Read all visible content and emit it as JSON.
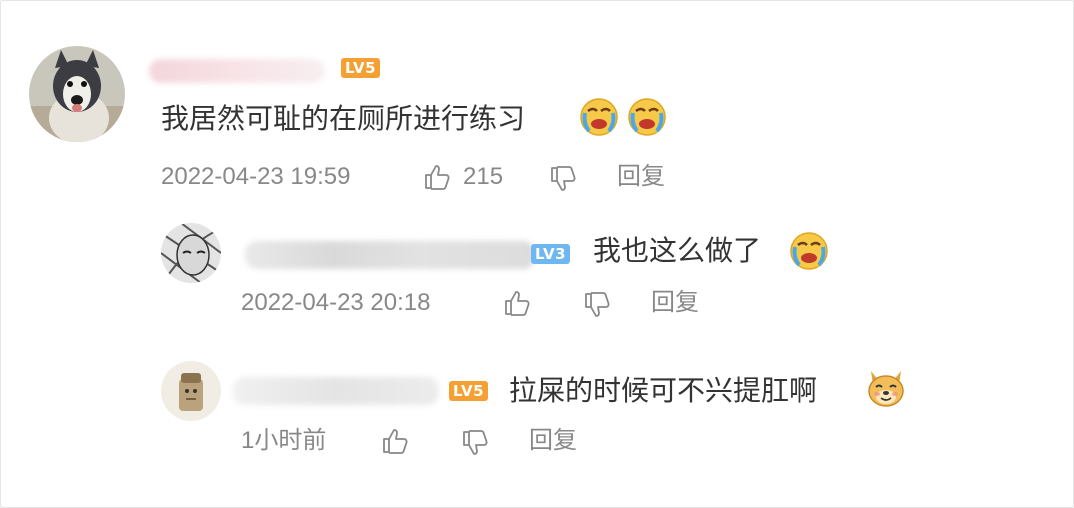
{
  "colors": {
    "badge_orange": "#f5a033",
    "badge_blue": "#6fb7f0",
    "meta_gray": "#888888",
    "text_dark": "#333333"
  },
  "comments": [
    {
      "badge": "LV5",
      "text": "我居然可耻的在厕所进行练习",
      "emojis": [
        "crying-face-icon",
        "crying-face-icon"
      ],
      "timestamp": "2022-04-23 19:59",
      "like_count": "215",
      "reply_label": "回复"
    },
    {
      "badge": "LV3",
      "text": "我也这么做了",
      "emojis": [
        "crying-face-icon"
      ],
      "timestamp": "2022-04-23 20:18",
      "reply_label": "回复"
    },
    {
      "badge": "LV5",
      "text": "拉屎的时候可不兴提肛啊",
      "emojis": [
        "doge-icon"
      ],
      "timestamp": "1小时前",
      "reply_label": "回复"
    }
  ]
}
